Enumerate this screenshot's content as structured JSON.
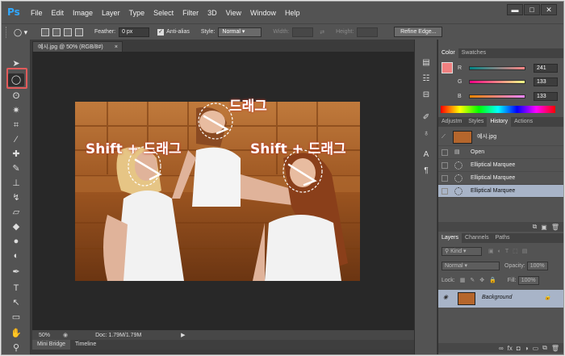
{
  "app": {
    "logo": "Ps",
    "menu": [
      "File",
      "Edit",
      "Image",
      "Layer",
      "Type",
      "Select",
      "Filter",
      "3D",
      "View",
      "Window",
      "Help"
    ],
    "window_buttons": [
      "minimize-icon",
      "maximize-icon",
      "close-icon"
    ]
  },
  "options": {
    "feather_label": "Feather:",
    "feather_value": "0 px",
    "antialias_label": "Anti-alias",
    "antialias_checked": true,
    "style_label": "Style:",
    "style_value": "Normal",
    "width_label": "Width:",
    "height_label": "Height:",
    "refine_label": "Refine Edge..."
  },
  "document": {
    "tab_title": "예시.jpg @ 50% (RGB/8#)",
    "close_glyph": "×",
    "zoom": "50%",
    "docinfo": "Doc: 1.79M/1.79M"
  },
  "annotations": {
    "drag": "드래그",
    "shift_left": "Shift + 드래그",
    "shift_right": "Shift + 드래그"
  },
  "bottom_tabs": [
    "Mini Bridge",
    "Timeline"
  ],
  "color_panel": {
    "tabs": [
      "Color",
      "Swatches"
    ],
    "foreground": "#f08080",
    "r_label": "R",
    "r_value": "241",
    "g_label": "G",
    "g_value": "133",
    "b_label": "B",
    "b_value": "133"
  },
  "history_panel": {
    "tabs": [
      "Adjustm",
      "Styles",
      "History",
      "Actions"
    ],
    "snapshot_name": "예시.jpg",
    "items": [
      "Open",
      "Elliptical Marquee",
      "Elliptical Marquee",
      "Elliptical Marquee"
    ]
  },
  "layers_panel": {
    "tabs": [
      "Layers",
      "Channels",
      "Paths"
    ],
    "kind_label": "Kind",
    "blend_mode": "Normal",
    "opacity_label": "Opacity:",
    "opacity_value": "100%",
    "lock_label": "Lock:",
    "fill_label": "Fill:",
    "fill_value": "100%",
    "layer_name": "Background"
  },
  "colors": {
    "highlight": "#e15b5b",
    "selection_row": "#a8b4c8"
  }
}
